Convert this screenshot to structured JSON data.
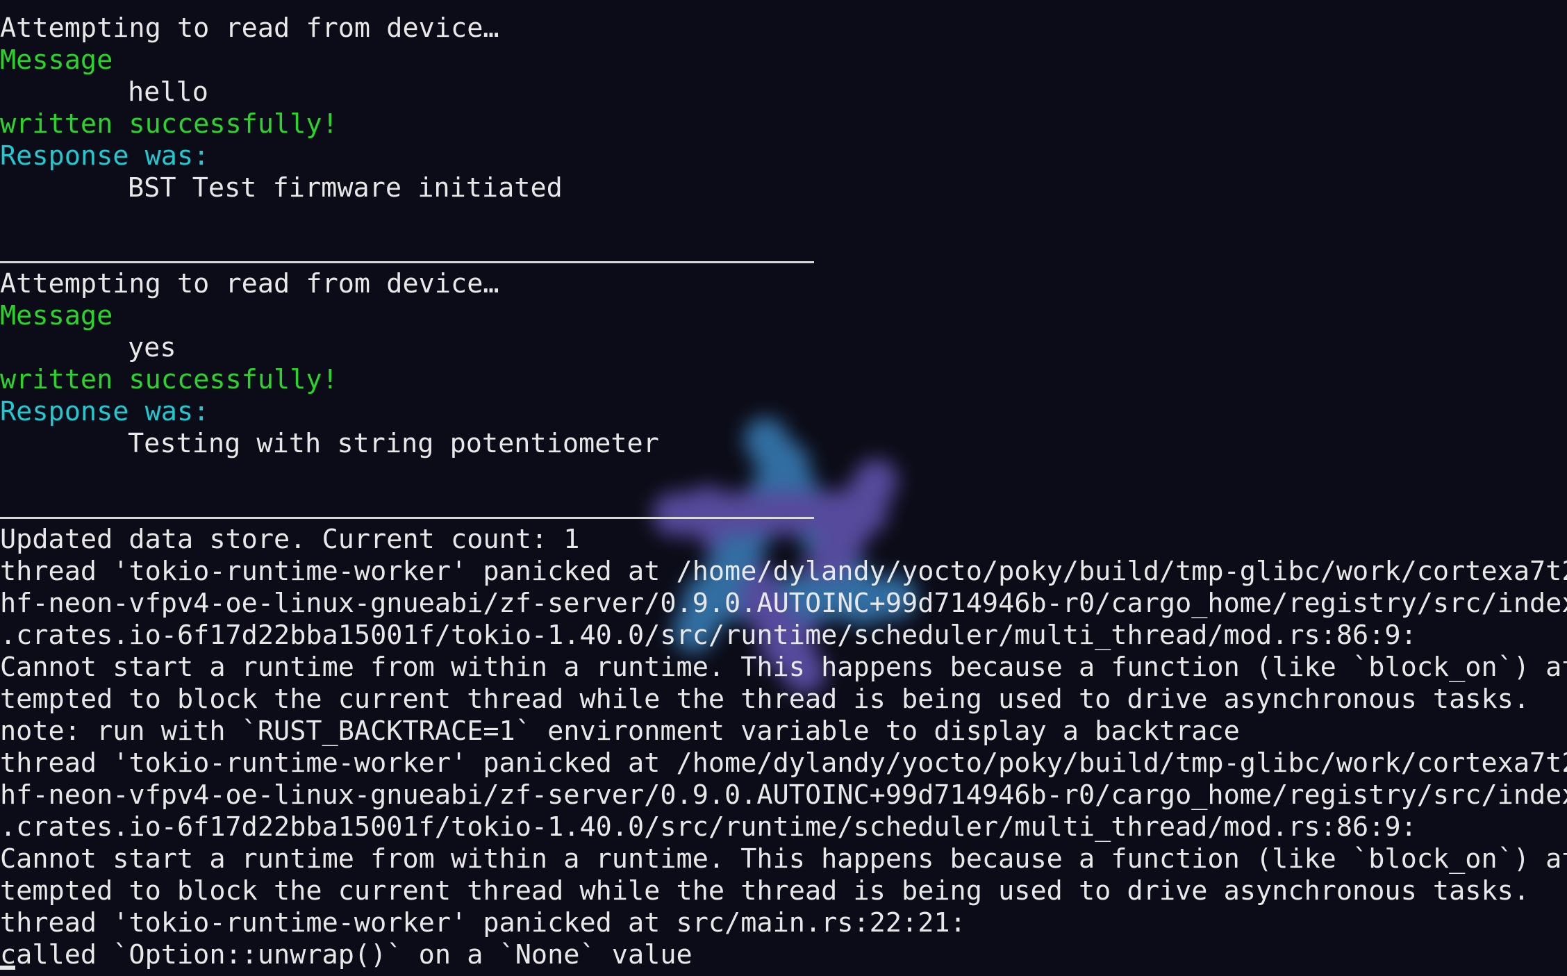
{
  "terminal": {
    "colors": {
      "background": "#0c0c18",
      "default_text": "#e8e8e8",
      "success": "#2bd42b",
      "info": "#20c8d0"
    },
    "watermark_icon": "nixos-snowflake-logo",
    "lines": [
      {
        "style": "white",
        "text": "Attempting to read from device…"
      },
      {
        "style": "green",
        "text": "Message"
      },
      {
        "style": "white",
        "indent": true,
        "text": "hello"
      },
      {
        "style": "green",
        "text": "written successfully!"
      },
      {
        "style": "cyan",
        "text": "Response was:"
      },
      {
        "style": "white",
        "indent": true,
        "text": "BST Test firmware initiated"
      },
      {
        "style": "blank",
        "text": ""
      },
      {
        "style": "separator",
        "text": ""
      },
      {
        "style": "white",
        "text": "Attempting to read from device…"
      },
      {
        "style": "green",
        "text": "Message"
      },
      {
        "style": "white",
        "indent": true,
        "text": "yes"
      },
      {
        "style": "green",
        "text": "written successfully!"
      },
      {
        "style": "cyan",
        "text": "Response was:"
      },
      {
        "style": "white",
        "indent": true,
        "text": "Testing with string potentiometer"
      },
      {
        "style": "blank",
        "text": ""
      },
      {
        "style": "separator",
        "text": ""
      },
      {
        "style": "white",
        "text": "Updated data store. Current count: 1"
      },
      {
        "style": "white",
        "text": "thread 'tokio-runtime-worker' panicked at /home/dylandy/yocto/poky/build/tmp-glibc/work/cortexa7t2"
      },
      {
        "style": "white",
        "text": "hf-neon-vfpv4-oe-linux-gnueabi/zf-server/0.9.0.AUTOINC+99d714946b-r0/cargo_home/registry/src/index"
      },
      {
        "style": "white",
        "text": ".crates.io-6f17d22bba15001f/tokio-1.40.0/src/runtime/scheduler/multi_thread/mod.rs:86:9:"
      },
      {
        "style": "white",
        "text": "Cannot start a runtime from within a runtime. This happens because a function (like `block_on`) at"
      },
      {
        "style": "white",
        "text": "tempted to block the current thread while the thread is being used to drive asynchronous tasks."
      },
      {
        "style": "white",
        "text": "note: run with `RUST_BACKTRACE=1` environment variable to display a backtrace"
      },
      {
        "style": "white",
        "text": "thread 'tokio-runtime-worker' panicked at /home/dylandy/yocto/poky/build/tmp-glibc/work/cortexa7t2"
      },
      {
        "style": "white",
        "text": "hf-neon-vfpv4-oe-linux-gnueabi/zf-server/0.9.0.AUTOINC+99d714946b-r0/cargo_home/registry/src/index"
      },
      {
        "style": "white",
        "text": ".crates.io-6f17d22bba15001f/tokio-1.40.0/src/runtime/scheduler/multi_thread/mod.rs:86:9:"
      },
      {
        "style": "white",
        "text": "Cannot start a runtime from within a runtime. This happens because a function (like `block_on`) at"
      },
      {
        "style": "white",
        "text": "tempted to block the current thread while the thread is being used to drive asynchronous tasks."
      },
      {
        "style": "white",
        "text": "thread 'tokio-runtime-worker' panicked at src/main.rs:22:21:"
      },
      {
        "style": "white",
        "text": "called `Option::unwrap()` on a `None` value"
      }
    ]
  }
}
